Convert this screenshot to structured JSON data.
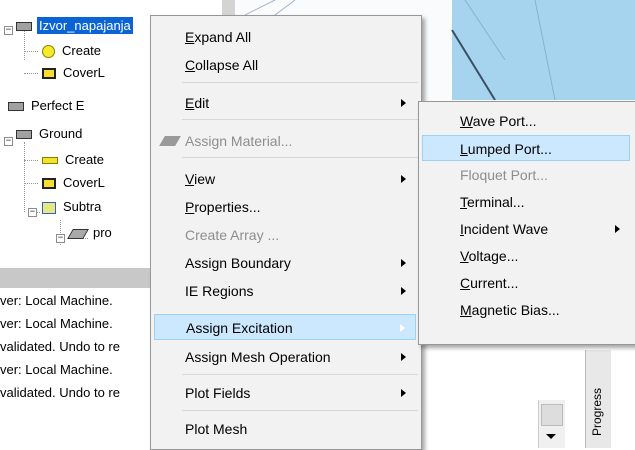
{
  "tree": {
    "nodes": [
      {
        "label": "Izvor_napajanja",
        "icon": "gray-rect"
      },
      {
        "label": "Create",
        "icon": "yellow-circle"
      },
      {
        "label": "CoverL",
        "icon": "cover"
      },
      {
        "label": "Perfect E",
        "icon": "gray-rect"
      },
      {
        "label": "Ground",
        "icon": "gray-rect"
      },
      {
        "label": "Create",
        "icon": "yellow-rect"
      },
      {
        "label": "CoverL",
        "icon": "cover"
      },
      {
        "label": "Subtra",
        "icon": "subtract"
      },
      {
        "label": "pro",
        "icon": "parallelogram"
      }
    ],
    "expander_minus": "−"
  },
  "messages": [
    "ver: Local Machine.",
    "ver: Local Machine.",
    "validated. Undo to re",
    "ver: Local Machine.",
    "validated. Undo to re"
  ],
  "progress_label": "Progress",
  "context_menu": {
    "items": [
      {
        "label": "Expand All",
        "ul": "E",
        "rest": "xpand All",
        "enabled": true,
        "submenu": false
      },
      {
        "label": "Collapse All",
        "ul": "C",
        "rest": "ollapse All",
        "enabled": true,
        "submenu": false
      },
      {
        "label": "Edit",
        "ul": "E",
        "rest": "dit",
        "enabled": true,
        "submenu": true
      },
      {
        "label": "Assign Material...",
        "enabled": false,
        "submenu": false,
        "icon": "assign-material-icon"
      },
      {
        "label": "View",
        "ul": "V",
        "rest": "iew",
        "enabled": true,
        "submenu": true
      },
      {
        "label": "Properties...",
        "ul": "P",
        "rest": "roperties...",
        "enabled": true,
        "submenu": false
      },
      {
        "label": "Create Array ...",
        "enabled": false,
        "submenu": false
      },
      {
        "label": "Assign Boundary",
        "enabled": true,
        "submenu": true
      },
      {
        "label": "IE Regions",
        "enabled": true,
        "submenu": true
      },
      {
        "label": "Assign Excitation",
        "enabled": true,
        "submenu": true,
        "highlighted": true
      },
      {
        "label": "Assign Mesh Operation",
        "enabled": true,
        "submenu": true
      },
      {
        "label": "Plot Fields",
        "enabled": true,
        "submenu": true
      },
      {
        "label": "Plot Mesh",
        "enabled": true,
        "submenu": false
      }
    ]
  },
  "excitation_submenu": {
    "items": [
      {
        "label": "Wave Port...",
        "enabled": true,
        "submenu": false
      },
      {
        "label": "Lumped Port...",
        "enabled": true,
        "submenu": false,
        "highlighted": true
      },
      {
        "label": "Floquet Port...",
        "enabled": false,
        "submenu": false
      },
      {
        "label": "Terminal...",
        "enabled": true,
        "submenu": false
      },
      {
        "label": "Incident Wave",
        "enabled": true,
        "submenu": true
      },
      {
        "label": "Voltage...",
        "enabled": true,
        "submenu": false
      },
      {
        "label": "Current...",
        "enabled": true,
        "submenu": false
      },
      {
        "label": "Magnetic Bias...",
        "enabled": true,
        "submenu": false
      }
    ]
  },
  "colors": {
    "selection": "#0a64d6",
    "menu_highlight": "#cce8ff",
    "menu_bg": "#f2f2f2",
    "disabled": "#8d8d8d",
    "view_accent": "#a6d4ee"
  }
}
